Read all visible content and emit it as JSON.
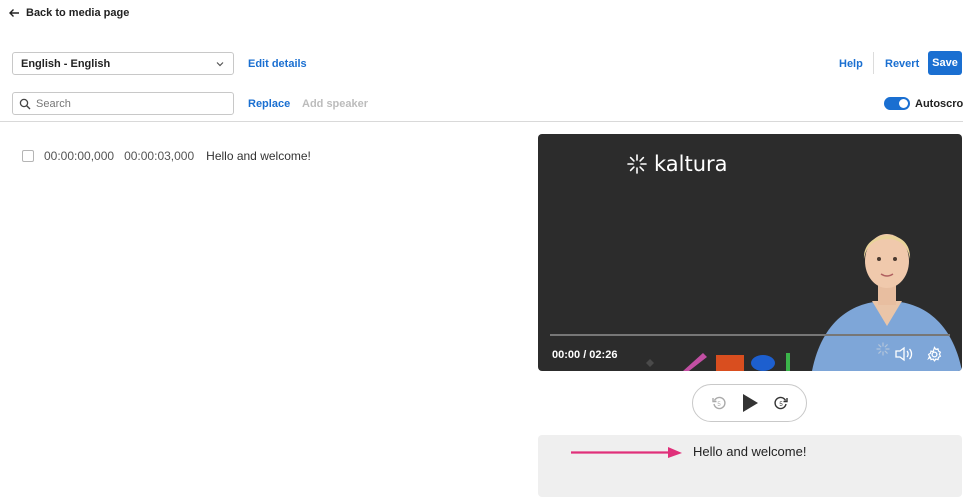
{
  "header": {
    "back_label": "Back to media page"
  },
  "toolbar": {
    "language_value": "English - English",
    "edit_details_label": "Edit details",
    "help_label": "Help",
    "revert_label": "Revert",
    "save_label": "Save",
    "search_placeholder": "Search",
    "replace_label": "Replace",
    "add_speaker_label": "Add speaker",
    "autoscroll_label": "Autoscroll",
    "autoscroll_on": true
  },
  "captions": [
    {
      "start": "00:00:00,000",
      "end": "00:00:03,000",
      "text": "Hello and welcome!"
    }
  ],
  "player": {
    "logo_text": "kaltura",
    "time_readout": "00:00 / 02:26",
    "progress_fraction": 0.0
  },
  "preview": {
    "text": "Hello and welcome!"
  },
  "colors": {
    "accent": "#1a6fd1",
    "arrow": "#e0307a",
    "player_bg": "#2c2c2c"
  }
}
